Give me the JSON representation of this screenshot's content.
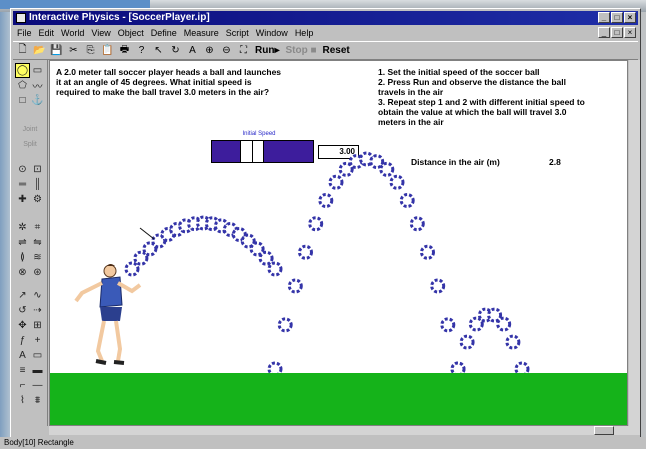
{
  "window": {
    "title": "Interactive Physics - [SoccerPlayer.ip]",
    "buttons": [
      "_",
      "□",
      "×"
    ]
  },
  "menu": {
    "items": [
      "File",
      "Edit",
      "World",
      "View",
      "Object",
      "Define",
      "Measure",
      "Script",
      "Window",
      "Help"
    ]
  },
  "toolbar": {
    "run_label": "Run▸",
    "stop_label": "Stop ■",
    "reset_label": "Reset"
  },
  "canvas": {
    "problem_text": "A 2.0 meter tall soccer player heads a ball and launches it at an angle of 45 degrees. What initial speed is required to make the ball travel 3.0 meters in the air?",
    "steps": [
      "1. Set the initial speed of the soccer ball",
      "2. Press Run and observe the distance the ball travels in the air",
      "3. Repeat step 1 and 2 with different initial speed to obtain the value at which the ball will travel 3.0 meters in the air"
    ],
    "slider": {
      "label": "Initial Speed",
      "value": "3.00",
      "level_fraction": 0.37
    },
    "distance": {
      "label": "Distance in the air (m)",
      "value": "2.8"
    },
    "colors": {
      "grass": "#15b31a",
      "ball": "#3434a8",
      "slider": "#3d1d9c"
    }
  },
  "palette": {
    "disabled_labels": [
      "Joint",
      "Split"
    ]
  },
  "status": {
    "text": "Body[10] Rectangle"
  }
}
